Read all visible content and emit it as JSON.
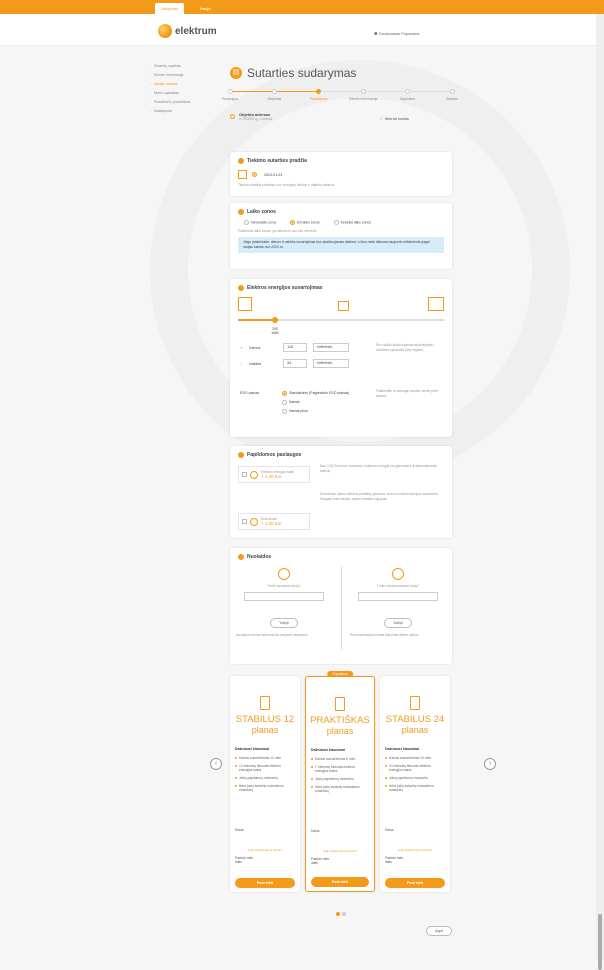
{
  "top_tabs": [
    "Valdymas",
    "Nauja"
  ],
  "brand": "elektrum",
  "user_name": "Grušauskas Popadana",
  "sidenav": [
    {
      "label": "Sutarčių sąrašas",
      "active": false
    },
    {
      "label": "Kliento informacija",
      "active": false
    },
    {
      "label": "Naujas sutartis",
      "active": true
    },
    {
      "label": "Mano sąskaitos",
      "active": false
    },
    {
      "label": "Pokalbiai ir pranešimai",
      "active": false
    },
    {
      "label": "Nustatymai",
      "active": false
    }
  ],
  "page_title": "Sutarties sudarymas",
  "steps": [
    "Paslaugos",
    "Objektas",
    "Pasiūlymas",
    "Kliento informacija",
    "Sąskaitos",
    "Sutartis"
  ],
  "active_step_index": 2,
  "object": {
    "label": "Objekto adresas",
    "value": "X 000000 g., Lietuva"
  },
  "client_card_label": "Kliento kodas",
  "start": {
    "title": "Tiekimo sutarties pradžia",
    "date": "2024-01-01",
    "note": "Tiekimo pradžia priklauso nuo energijos tiekimo ir objekto patikros"
  },
  "zones": {
    "title": "Laiko zonos",
    "options": [
      "Viena laiko zona",
      "Dvi laiko zonos",
      "Keturios laiko zonos"
    ],
    "selected_index": 1,
    "note": "Pasirinkus laiko zonas, jos taikomos nuo kito mėnesio",
    "info": "Jeigu pasirinksite, dienos ir nakties suvartojimas bus skaičiuojamas atskirai, o šiuo metu laikoma naujomis reikšmėmis pagal naujas kainas nuo 2024 m."
  },
  "consumption": {
    "title": "Elektros energijos suvartojimas",
    "kwh_value": "200",
    "kwh_unit": "kWh",
    "slider_fraction": 0.18,
    "rows": [
      {
        "label": "Dienos",
        "value": "116",
        "unit": "kWh/mėn."
      },
      {
        "label": "Nakties",
        "value": "84",
        "unit": "kWh/mėn."
      }
    ],
    "eso_label": "ESO planas",
    "eso_options": [
      "Standartinis (Pagrindinis ESO planas)",
      "Namai",
      "Namai plius"
    ],
    "eso_selected": 0,
    "side_note_1": "Šis rodiklis skaičiuojamas atsižvelgiant į vidutines sąnaudas jūsų regione.",
    "side_note_2": "Patikrinkite ar teisingai įvestos vertės prieš tęsiant."
  },
  "extras": {
    "title": "Papildomos paslaugos",
    "items": [
      {
        "name": "Elektros energija žaliai",
        "price": "+ 2,00 Eur"
      },
      {
        "name": "Draudimas",
        "price": "+ 1,00 Eur"
      }
    ],
    "desc_1": "Nuo 2,00 Eur/mėn. mokesčio, tiekiama energija yra gaminama iš atsinaujinančių šaltinių.",
    "desc_2": "Draudimas apima elektros prietaisų gedimus, kuriuos sukelia įtampos svyravimai. Daugiau informacijos rasite sutarties sąlygose."
  },
  "discounts": {
    "title": "Nuolaidos",
    "left_label": "Turite nuolaidos kodą?",
    "right_label": "Turite rekomendacijos kodą?",
    "apply": "Taikyti",
    "left_note": "Nuolaidos kodas taikomas tik naujiems klientams",
    "right_note": "Rekomendacijos kodas taikomas abiem šalims."
  },
  "plans": [
    {
      "name": "STABILUS 12",
      "sub": "planas",
      "featured": false,
      "heading": "Dažniausi klausimai",
      "features": [
        "Kainos sumažinimas 12 mėn.",
        "12 mėnesių fiksuota elektros energijos kaina",
        "Jokių papildomų mokesčių",
        "Nėra jokių sutarčių nutraukimo mokesčių"
      ],
      "price_label": "Kaina",
      "link": "Kaip skaičiuojama kaina?",
      "month_label": "Pastovi mėn. dalis",
      "cta": "Pasirinkti"
    },
    {
      "name": "PRAKTIŠKAS",
      "sub": "planas",
      "featured": true,
      "flag": "Populiarus",
      "heading": "Dažniausi klausimai",
      "features": [
        "Kainos sumažinimas 6 mėn.",
        "7 mėnesių fiksuota elektros energijos kaina",
        "Jokių papildomų mokesčių",
        "Nėra jokių sutarčių nutraukimo mokesčių"
      ],
      "price_label": "Kaina",
      "link": "Kaip skaičiuojama kaina?",
      "month_label": "Pastovi mėn. dalis",
      "cta": "Pasirinkti"
    },
    {
      "name": "STABILUS 24",
      "sub": "planas",
      "featured": false,
      "heading": "Dažniausi klausimai",
      "features": [
        "Kainos sumažinimas 24 mėn.",
        "24 mėnesių fiksuota elektros energijos kaina",
        "Jokių papildomų mokesčių",
        "Nėra jokių sutarčių nutraukimo mokesčių"
      ],
      "price_label": "Kaina",
      "link": "Kaip skaičiuojama kaina?",
      "month_label": "Pastovi mėn. dalis",
      "cta": "Pasirinkti"
    }
  ],
  "back_label": "Atgal"
}
